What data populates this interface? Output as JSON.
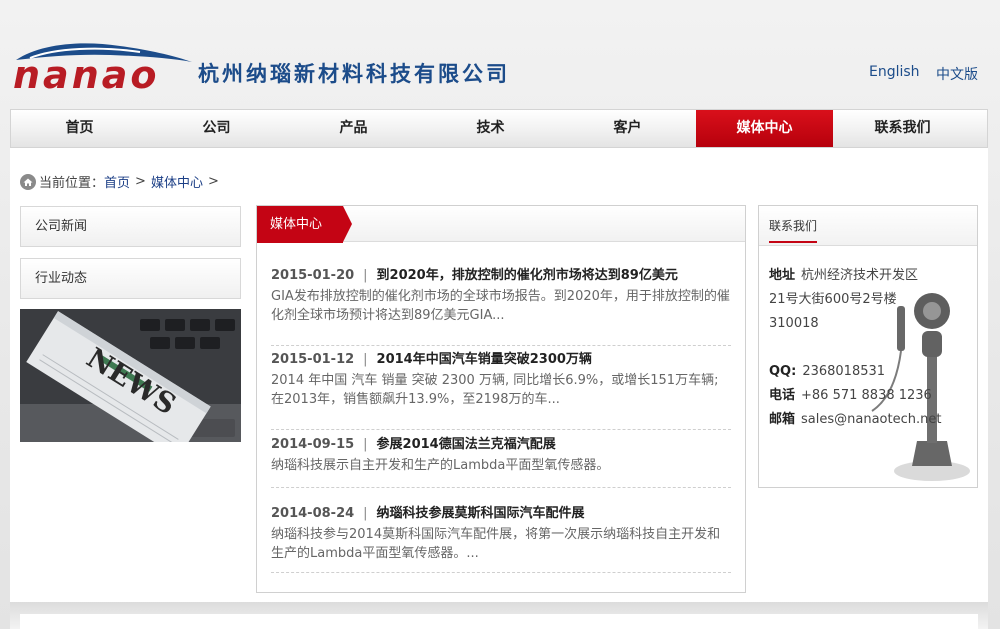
{
  "header": {
    "logo_text": "nanao",
    "company_name": "杭州纳瑙新材料科技有限公司",
    "lang_en": "English",
    "lang_cn": "中文版"
  },
  "nav": {
    "items": [
      "首页",
      "公司",
      "产品",
      "技术",
      "客户",
      "媒体中心",
      "联系我们"
    ],
    "active": "媒体中心"
  },
  "breadcrumb": {
    "prefix": "当前位置：",
    "home": "首页",
    "current": "媒体中心",
    "sep": ">"
  },
  "sidebar": {
    "items": [
      "公司新闻",
      "行业动态"
    ],
    "image_word": "NEWS"
  },
  "center": {
    "tab": "媒体中心",
    "news": [
      {
        "date": "2015-01-20",
        "title": "到2020年，排放控制的催化剂市场将达到89亿美元",
        "summary": "GIA发布排放控制的催化剂市场的全球市场报告。到2020年，用于排放控制的催化剂全球市场预计将达到89亿美元GIA..."
      },
      {
        "date": "2015-01-12",
        "title": "2014年中国汽车销量突破2300万辆",
        "summary": "2014 年中国 汽车 销量 突破 2300 万辆, 同比增长6.9%，或增长151万车辆; 在2013年，销售额飙升13.9%，至2198万的车..."
      },
      {
        "date": "2014-09-15",
        "title": "参展2014德国法兰克福汽配展",
        "summary": "纳瑙科技展示自主开发和生产的Lambda平面型氧传感器。"
      },
      {
        "date": "2014-08-24",
        "title": "纳瑙科技参展莫斯科国际汽车配件展",
        "summary": "纳瑙科技参与2014莫斯科国际汽车配件展，将第一次展示纳瑙科技自主开发和生产的Lambda平面型氧传感器。..."
      }
    ]
  },
  "contact": {
    "title": "联系我们",
    "address_label": "地址",
    "address_lines": [
      "杭州经济技术开发区",
      "21号大街600号2号楼",
      "310018"
    ],
    "qq_label": "QQ:",
    "qq": "2368018531",
    "phone_label": "电话",
    "phone": "+86 571 8838 1236",
    "email_label": "邮箱",
    "email": "sales@nanaotech.net"
  },
  "colors": {
    "brand_blue": "#1c4c8a",
    "accent_red": "#c40414"
  }
}
